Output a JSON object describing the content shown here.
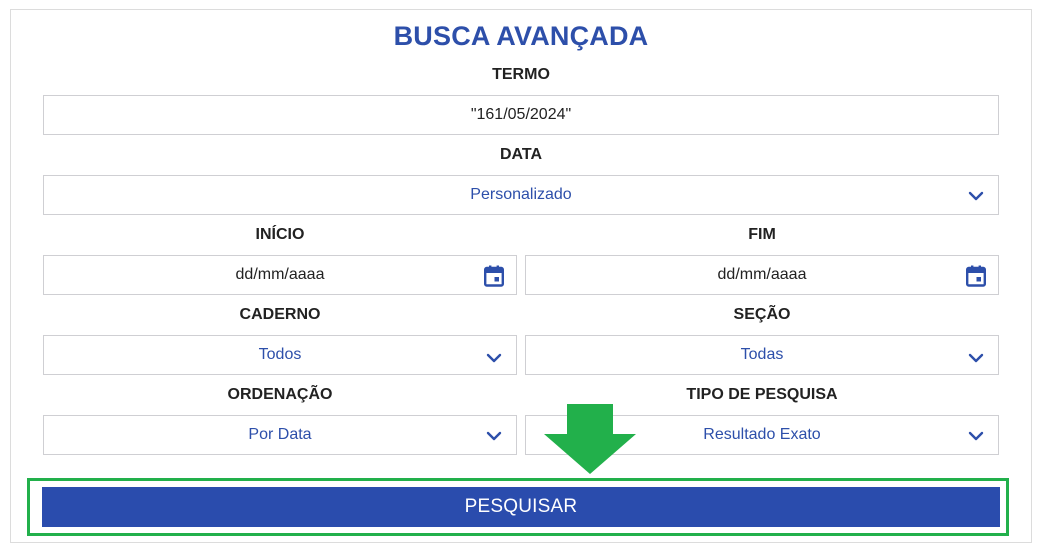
{
  "title": "BUSCA AVANÇADA",
  "termo": {
    "label": "TERMO",
    "value": "\"161/05/2024\""
  },
  "data": {
    "label": "DATA",
    "selected": "Personalizado"
  },
  "inicio": {
    "label": "INÍCIO",
    "placeholder": "dd/mm/aaaa"
  },
  "fim": {
    "label": "FIM",
    "placeholder": "dd/mm/aaaa"
  },
  "caderno": {
    "label": "CADERNO",
    "selected": "Todos"
  },
  "secao": {
    "label": "SEÇÃO",
    "selected": "Todas"
  },
  "ordenacao": {
    "label": "ORDENAÇÃO",
    "selected": "Por Data"
  },
  "tipo": {
    "label": "TIPO DE PESQUISA",
    "selected": "Resultado Exato"
  },
  "submit": {
    "label": "PESQUISAR"
  },
  "colors": {
    "accent": "#2d4faa",
    "button": "#2a4cad",
    "highlight": "#22b04b"
  },
  "icons": {
    "select": "chevron-down-icon",
    "date": "calendar-icon",
    "annotation": "down-arrow-icon"
  }
}
